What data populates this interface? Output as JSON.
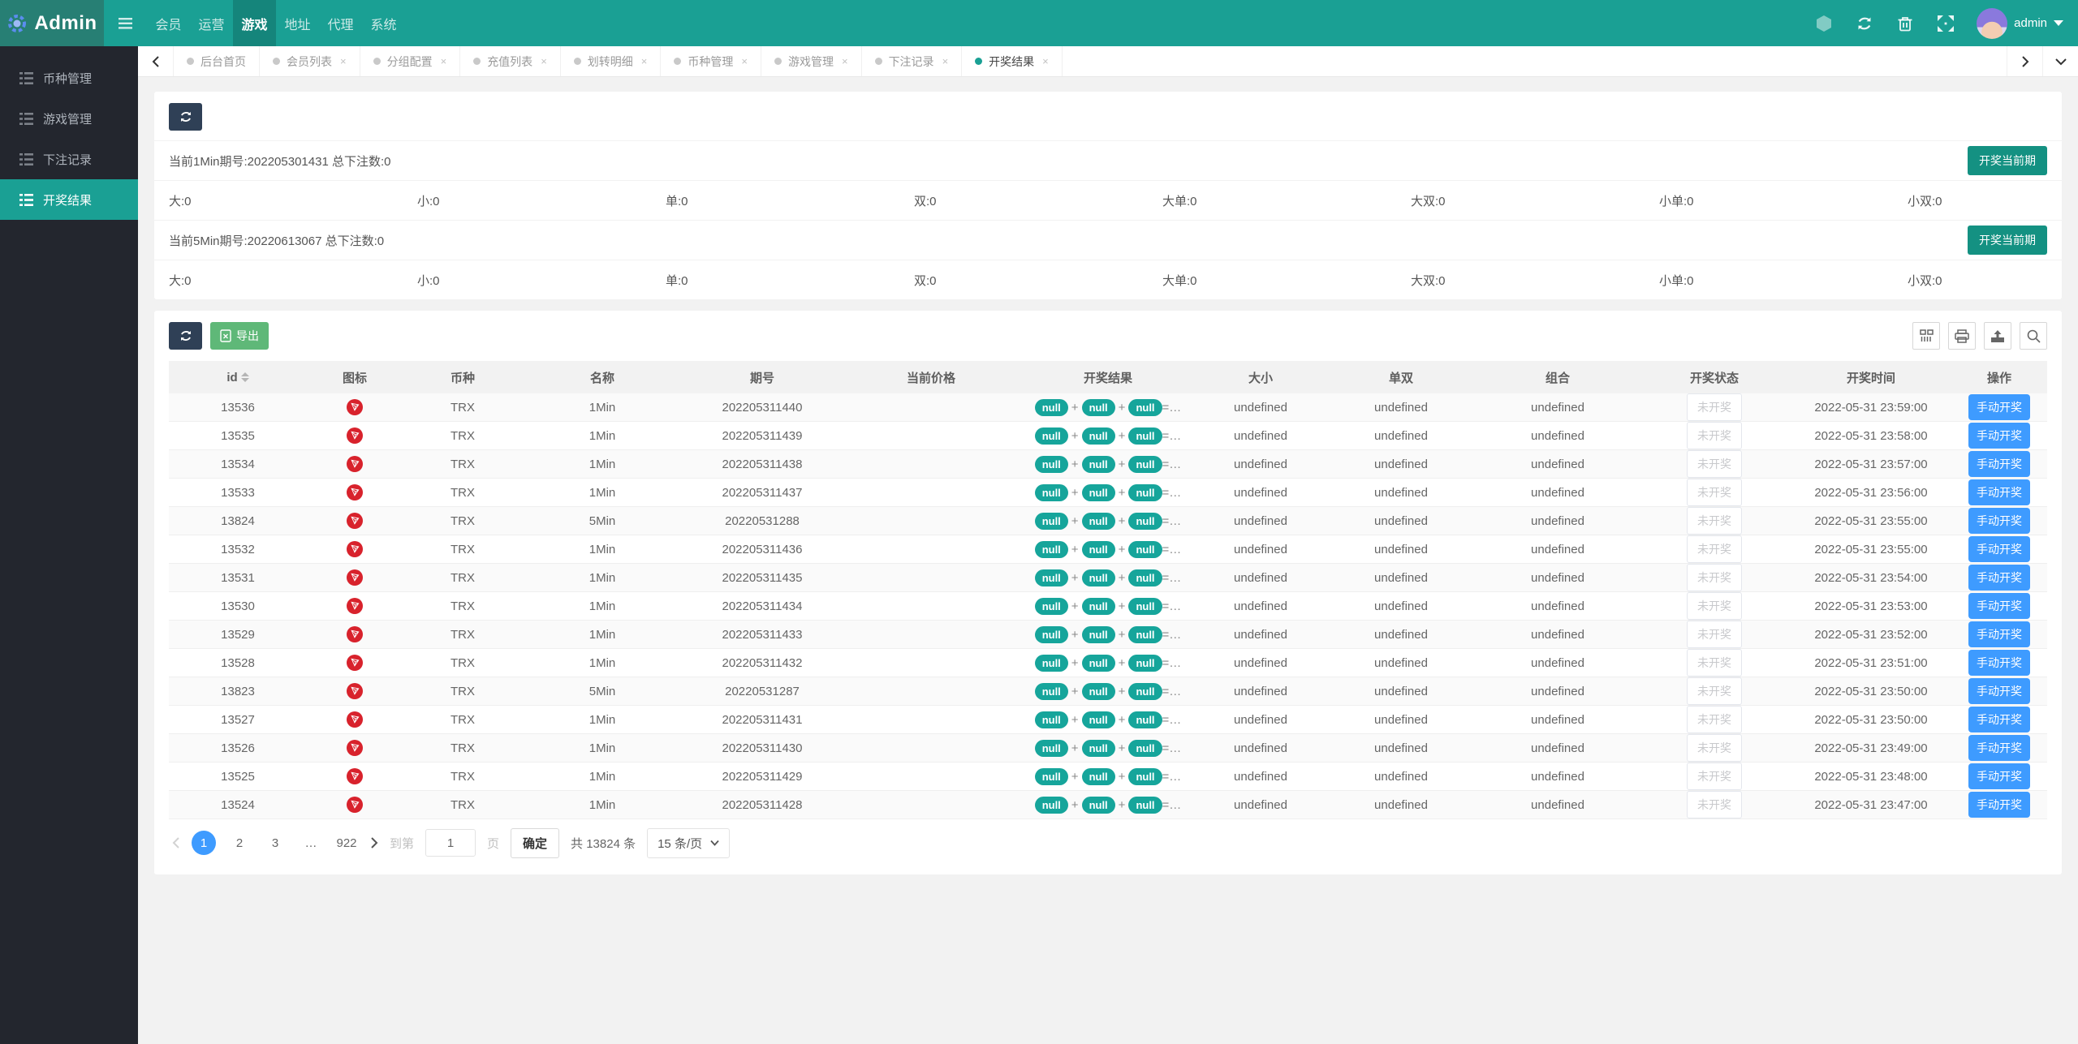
{
  "navbar": {
    "logo": "Admin",
    "items": [
      "会员",
      "运营",
      "游戏",
      "地址",
      "代理",
      "系统"
    ],
    "active_item": "游戏",
    "username": "admin"
  },
  "sidebar": {
    "items": [
      "币种管理",
      "游戏管理",
      "下注记录",
      "开奖结果"
    ],
    "active_item": "开奖结果"
  },
  "tabbar": {
    "tabs": [
      "后台首页",
      "会员列表",
      "分组配置",
      "充值列表",
      "划转明细",
      "币种管理",
      "游戏管理",
      "下注记录",
      "开奖结果"
    ],
    "active_tab": "开奖结果",
    "close_glyph": "×"
  },
  "periods": {
    "p1": {
      "label": "当前1Min期号:202205301431 总下注数:0",
      "open_button": "开奖当前期",
      "stats": [
        "大:0",
        "小:0",
        "单:0",
        "双:0",
        "大单:0",
        "大双:0",
        "小单:0",
        "小双:0"
      ]
    },
    "p2": {
      "label": "当前5Min期号:20220613067 总下注数:0",
      "open_button": "开奖当前期",
      "stats": [
        "大:0",
        "小:0",
        "单:0",
        "双:0",
        "大单:0",
        "大双:0",
        "小单:0",
        "小双:0"
      ]
    }
  },
  "toolbar": {
    "export_label": "导出"
  },
  "table": {
    "headers": [
      "id",
      "图标",
      "币种",
      "名称",
      "期号",
      "当前价格",
      "开奖结果",
      "大小",
      "单双",
      "组合",
      "开奖状态",
      "开奖时间",
      "操作"
    ],
    "rows": [
      {
        "id": "13536",
        "coin": "TRX",
        "name": "1Min",
        "issue": "202205311440",
        "price": "",
        "result": [
          "null",
          "null",
          "null"
        ],
        "result_tail": "=…",
        "size": "undefined",
        "parity": "undefined",
        "combo": "undefined",
        "status": "未开奖",
        "time": "2022-05-31 23:59:00",
        "action": "手动开奖"
      },
      {
        "id": "13535",
        "coin": "TRX",
        "name": "1Min",
        "issue": "202205311439",
        "price": "",
        "result": [
          "null",
          "null",
          "null"
        ],
        "result_tail": "=…",
        "size": "undefined",
        "parity": "undefined",
        "combo": "undefined",
        "status": "未开奖",
        "time": "2022-05-31 23:58:00",
        "action": "手动开奖"
      },
      {
        "id": "13534",
        "coin": "TRX",
        "name": "1Min",
        "issue": "202205311438",
        "price": "",
        "result": [
          "null",
          "null",
          "null"
        ],
        "result_tail": "=…",
        "size": "undefined",
        "parity": "undefined",
        "combo": "undefined",
        "status": "未开奖",
        "time": "2022-05-31 23:57:00",
        "action": "手动开奖"
      },
      {
        "id": "13533",
        "coin": "TRX",
        "name": "1Min",
        "issue": "202205311437",
        "price": "",
        "result": [
          "null",
          "null",
          "null"
        ],
        "result_tail": "=…",
        "size": "undefined",
        "parity": "undefined",
        "combo": "undefined",
        "status": "未开奖",
        "time": "2022-05-31 23:56:00",
        "action": "手动开奖"
      },
      {
        "id": "13824",
        "coin": "TRX",
        "name": "5Min",
        "issue": "20220531288",
        "price": "",
        "result": [
          "null",
          "null",
          "null"
        ],
        "result_tail": "=…",
        "size": "undefined",
        "parity": "undefined",
        "combo": "undefined",
        "status": "未开奖",
        "time": "2022-05-31 23:55:00",
        "action": "手动开奖"
      },
      {
        "id": "13532",
        "coin": "TRX",
        "name": "1Min",
        "issue": "202205311436",
        "price": "",
        "result": [
          "null",
          "null",
          "null"
        ],
        "result_tail": "=…",
        "size": "undefined",
        "parity": "undefined",
        "combo": "undefined",
        "status": "未开奖",
        "time": "2022-05-31 23:55:00",
        "action": "手动开奖"
      },
      {
        "id": "13531",
        "coin": "TRX",
        "name": "1Min",
        "issue": "202205311435",
        "price": "",
        "result": [
          "null",
          "null",
          "null"
        ],
        "result_tail": "=…",
        "size": "undefined",
        "parity": "undefined",
        "combo": "undefined",
        "status": "未开奖",
        "time": "2022-05-31 23:54:00",
        "action": "手动开奖"
      },
      {
        "id": "13530",
        "coin": "TRX",
        "name": "1Min",
        "issue": "202205311434",
        "price": "",
        "result": [
          "null",
          "null",
          "null"
        ],
        "result_tail": "=…",
        "size": "undefined",
        "parity": "undefined",
        "combo": "undefined",
        "status": "未开奖",
        "time": "2022-05-31 23:53:00",
        "action": "手动开奖"
      },
      {
        "id": "13529",
        "coin": "TRX",
        "name": "1Min",
        "issue": "202205311433",
        "price": "",
        "result": [
          "null",
          "null",
          "null"
        ],
        "result_tail": "=…",
        "size": "undefined",
        "parity": "undefined",
        "combo": "undefined",
        "status": "未开奖",
        "time": "2022-05-31 23:52:00",
        "action": "手动开奖"
      },
      {
        "id": "13528",
        "coin": "TRX",
        "name": "1Min",
        "issue": "202205311432",
        "price": "",
        "result": [
          "null",
          "null",
          "null"
        ],
        "result_tail": "=…",
        "size": "undefined",
        "parity": "undefined",
        "combo": "undefined",
        "status": "未开奖",
        "time": "2022-05-31 23:51:00",
        "action": "手动开奖"
      },
      {
        "id": "13823",
        "coin": "TRX",
        "name": "5Min",
        "issue": "20220531287",
        "price": "",
        "result": [
          "null",
          "null",
          "null"
        ],
        "result_tail": "=…",
        "size": "undefined",
        "parity": "undefined",
        "combo": "undefined",
        "status": "未开奖",
        "time": "2022-05-31 23:50:00",
        "action": "手动开奖"
      },
      {
        "id": "13527",
        "coin": "TRX",
        "name": "1Min",
        "issue": "202205311431",
        "price": "",
        "result": [
          "null",
          "null",
          "null"
        ],
        "result_tail": "=…",
        "size": "undefined",
        "parity": "undefined",
        "combo": "undefined",
        "status": "未开奖",
        "time": "2022-05-31 23:50:00",
        "action": "手动开奖"
      },
      {
        "id": "13526",
        "coin": "TRX",
        "name": "1Min",
        "issue": "202205311430",
        "price": "",
        "result": [
          "null",
          "null",
          "null"
        ],
        "result_tail": "=…",
        "size": "undefined",
        "parity": "undefined",
        "combo": "undefined",
        "status": "未开奖",
        "time": "2022-05-31 23:49:00",
        "action": "手动开奖"
      },
      {
        "id": "13525",
        "coin": "TRX",
        "name": "1Min",
        "issue": "202205311429",
        "price": "",
        "result": [
          "null",
          "null",
          "null"
        ],
        "result_tail": "=…",
        "size": "undefined",
        "parity": "undefined",
        "combo": "undefined",
        "status": "未开奖",
        "time": "2022-05-31 23:48:00",
        "action": "手动开奖"
      },
      {
        "id": "13524",
        "coin": "TRX",
        "name": "1Min",
        "issue": "202205311428",
        "price": "",
        "result": [
          "null",
          "null",
          "null"
        ],
        "result_tail": "=…",
        "size": "undefined",
        "parity": "undefined",
        "combo": "undefined",
        "status": "未开奖",
        "time": "2022-05-31 23:47:00",
        "action": "手动开奖"
      }
    ]
  },
  "pagination": {
    "pages": [
      "1",
      "2",
      "3",
      "…",
      "922"
    ],
    "active_page": "1",
    "goto_label": "到第",
    "goto_value": "1",
    "page_unit": "页",
    "confirm_label": "确定",
    "total_label": "共 13824 条",
    "page_size_label": "15 条/页"
  },
  "icons": {
    "menu-toggle-icon": "hamburger bars",
    "theme-icon": "hexagon",
    "refresh-icon": "circular arrows",
    "clear-cache-icon": "trash can",
    "fullscreen-icon": "expand arrows",
    "list-icon": "menu list bars",
    "export-file-icon": "excel file",
    "columns-icon": "column filter",
    "print-icon": "printer",
    "download-icon": "export box",
    "search-icon": "magnifier",
    "trx-coin-icon": "TRON logo in red circle",
    "sort-icon": "up/down carets"
  },
  "colors": {
    "accent_teal": "#1AA094",
    "navbar_active": "#15857B",
    "sidebar_bg": "#23262E",
    "dark_button": "#2F4056",
    "green_button": "#5FB878",
    "teal_button": "#149182",
    "blue_button": "#3E9BFF",
    "badge_teal": "#16A59B",
    "coin_red": "#D8222C"
  }
}
